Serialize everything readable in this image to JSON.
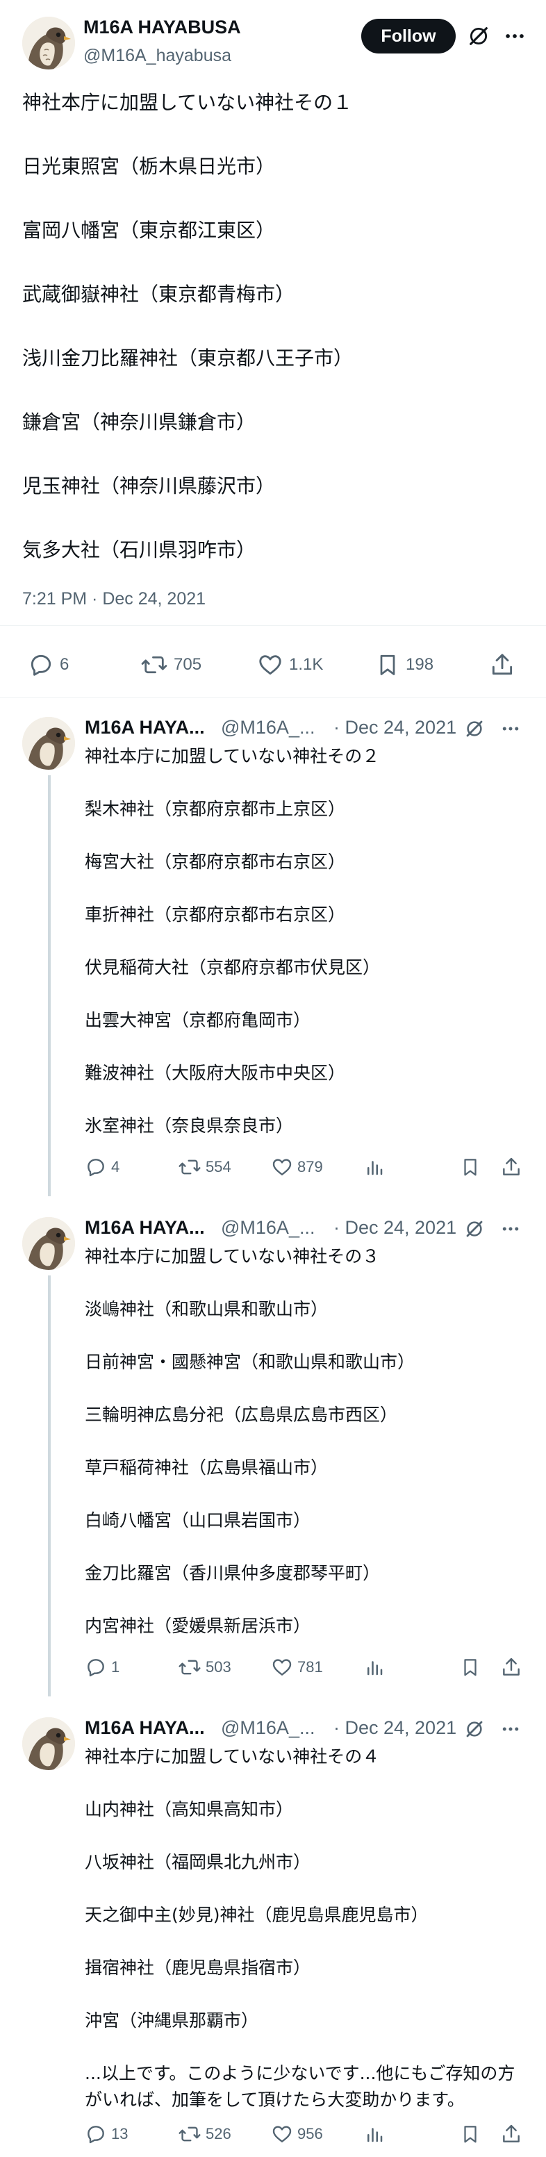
{
  "main_tweet": {
    "author_name": "M16A HAYABUSA",
    "author_handle": "@M16A_hayabusa",
    "follow_label": "Follow",
    "lines": [
      "神社本庁に加盟していない神社その１",
      "日光東照宮（栃木県日光市）",
      "富岡八幡宮（東京都江東区）",
      "武蔵御嶽神社（東京都青梅市）",
      "浅川金刀比羅神社（東京都八王子市）",
      "鎌倉宮（神奈川県鎌倉市）",
      "児玉神社（神奈川県藤沢市）",
      "気多大社（石川県羽咋市）"
    ],
    "timestamp": "7:21 PM · Dec 24, 2021",
    "stats": {
      "replies": "6",
      "retweets": "705",
      "likes": "1.1K",
      "bookmarks": "198"
    }
  },
  "replies": [
    {
      "author_name": "M16A HAYA...",
      "author_handle": "@M16A_...",
      "date": "· Dec 24, 2021",
      "lines": [
        "神社本庁に加盟していない神社その２",
        "",
        "梨木神社（京都府京都市上京区）",
        "",
        "梅宮大社（京都府京都市右京区）",
        "",
        "車折神社（京都府京都市右京区）",
        "",
        "伏見稲荷大社（京都府京都市伏見区）",
        "",
        "出雲大神宮（京都府亀岡市）",
        "",
        "難波神社（大阪府大阪市中央区）",
        "",
        "氷室神社（奈良県奈良市）"
      ],
      "stats": {
        "replies": "4",
        "retweets": "554",
        "likes": "879"
      }
    },
    {
      "author_name": "M16A HAYA...",
      "author_handle": "@M16A_...",
      "date": "· Dec 24, 2021",
      "lines": [
        "神社本庁に加盟していない神社その３",
        "",
        "淡嶋神社（和歌山県和歌山市）",
        "",
        "日前神宮・國懸神宮（和歌山県和歌山市）",
        "",
        "三輪明神広島分祀（広島県広島市西区）",
        "",
        "草戸稲荷神社（広島県福山市）",
        "",
        "白崎八幡宮（山口県岩国市）",
        "",
        "金刀比羅宮（香川県仲多度郡琴平町）",
        "",
        "内宮神社（愛媛県新居浜市）"
      ],
      "stats": {
        "replies": "1",
        "retweets": "503",
        "likes": "781"
      }
    },
    {
      "author_name": "M16A HAYA...",
      "author_handle": "@M16A_...",
      "date": "· Dec 24, 2021",
      "lines": [
        "神社本庁に加盟していない神社その４",
        "",
        "山内神社（高知県高知市）",
        "",
        "八坂神社（福岡県北九州市）",
        "",
        "天之御中主(妙見)神社（鹿児島県鹿児島市）",
        "",
        "揖宿神社（鹿児島県指宿市）",
        "",
        "沖宮（沖縄県那覇市）",
        "",
        "...以上です。このように少ないです...他にもご存知の方がいれば、加筆をして頂けたら大変助かります。"
      ],
      "stats": {
        "replies": "13",
        "retweets": "526",
        "likes": "956"
      }
    }
  ],
  "icons": {
    "reply": "reply-icon",
    "retweet": "retweet-icon",
    "like": "heart-icon",
    "bookmark": "bookmark-icon",
    "share": "share-icon",
    "views": "views-icon",
    "grok": "grok-icon",
    "more": "more-icon"
  },
  "colors": {
    "text_primary": "#0f1419",
    "text_secondary": "#536471",
    "divider": "#eff3f4",
    "thread_line": "#cfd9de",
    "button_bg": "#0f1419"
  }
}
